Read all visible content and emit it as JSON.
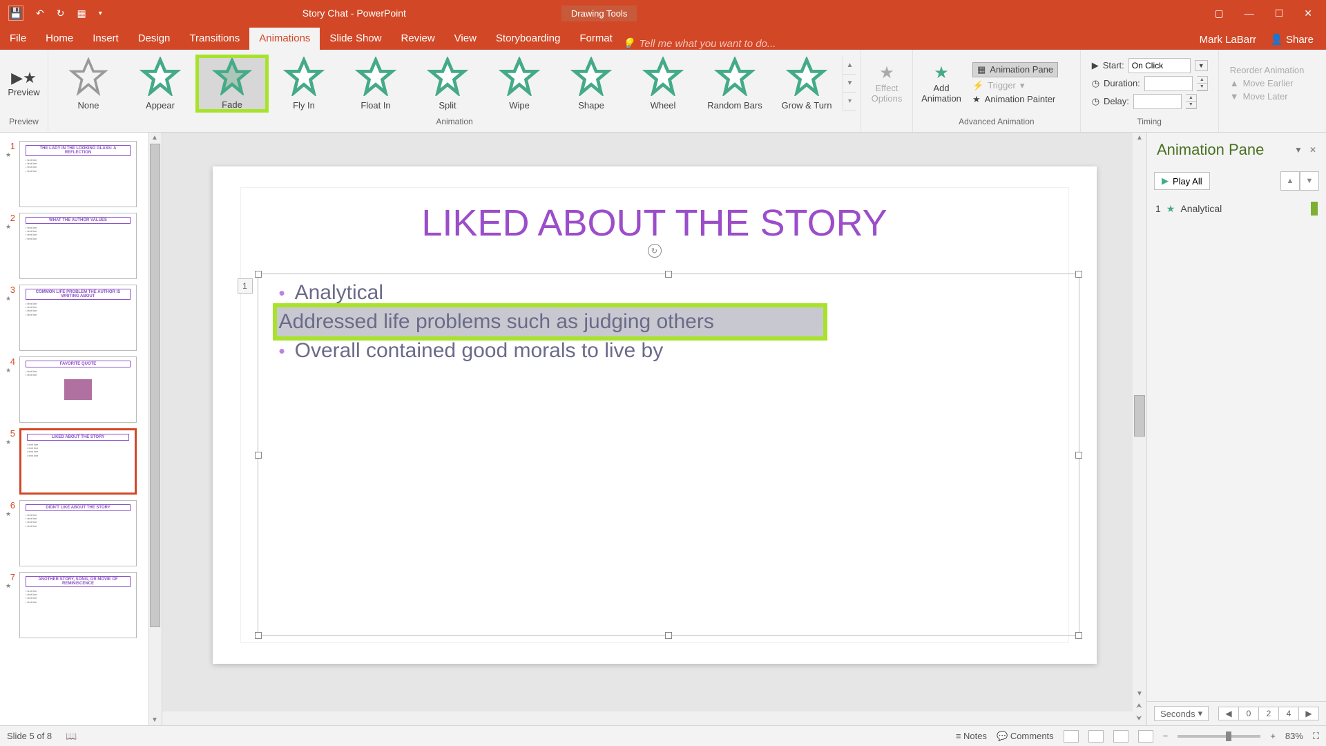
{
  "titlebar": {
    "title": "Story Chat - PowerPoint",
    "context_tool": "Drawing Tools"
  },
  "tabs": {
    "file": "File",
    "home": "Home",
    "insert": "Insert",
    "design": "Design",
    "transitions": "Transitions",
    "animations": "Animations",
    "slideshow": "Slide Show",
    "review": "Review",
    "view": "View",
    "storyboarding": "Storyboarding",
    "format": "Format",
    "tell": "Tell me what you want to do...",
    "user": "Mark LaBarr",
    "share": "Share"
  },
  "ribbon": {
    "preview": {
      "btn": "Preview",
      "label": "Preview"
    },
    "gallery": {
      "none": "None",
      "appear": "Appear",
      "fade": "Fade",
      "flyin": "Fly In",
      "floatin": "Float In",
      "split": "Split",
      "wipe": "Wipe",
      "shape": "Shape",
      "wheel": "Wheel",
      "random": "Random Bars",
      "grow": "Grow & Turn",
      "label": "Animation"
    },
    "effect": {
      "btn": "Effect\nOptions"
    },
    "addanim": {
      "btn": "Add\nAnimation"
    },
    "adv": {
      "pane": "Animation Pane",
      "trigger": "Trigger",
      "painter": "Animation Painter",
      "label": "Advanced Animation"
    },
    "timing": {
      "start": "Start:",
      "start_val": "On Click",
      "duration": "Duration:",
      "delay": "Delay:",
      "reorder": "Reorder Animation",
      "earlier": "Move Earlier",
      "later": "Move Later",
      "label": "Timing"
    }
  },
  "thumbs": [
    {
      "n": "1",
      "title": "THE LADY IN THE LOOKING GLASS: A REFLECTION"
    },
    {
      "n": "2",
      "title": "WHAT THE AUTHOR VALUES"
    },
    {
      "n": "3",
      "title": "COMMON LIFE PROBLEM THE AUTHOR IS WRITING ABOUT"
    },
    {
      "n": "4",
      "title": "FAVORITE QUOTE"
    },
    {
      "n": "5",
      "title": "LIKED ABOUT THE STORY"
    },
    {
      "n": "6",
      "title": "DIDN'T LIKE ABOUT THE STORY"
    },
    {
      "n": "7",
      "title": "ANOTHER STORY, SONG, OR MOVIE OF REMINISCENCE"
    }
  ],
  "slide": {
    "title": "LIKED ABOUT THE STORY",
    "bullet1": "Analytical",
    "bullet2": "Addressed life problems such as judging others",
    "bullet3": "Overall contained good morals to live by",
    "seq": "1"
  },
  "anim_pane": {
    "title": "Animation Pane",
    "play": "Play All",
    "item_n": "1",
    "item_star": "★",
    "item_name": "Analytical",
    "seconds": "Seconds",
    "t0": "0",
    "t2": "2",
    "t4": "4"
  },
  "status": {
    "slide": "Slide 5 of 8",
    "notes": "Notes",
    "comments": "Comments",
    "zoom": "83%"
  }
}
